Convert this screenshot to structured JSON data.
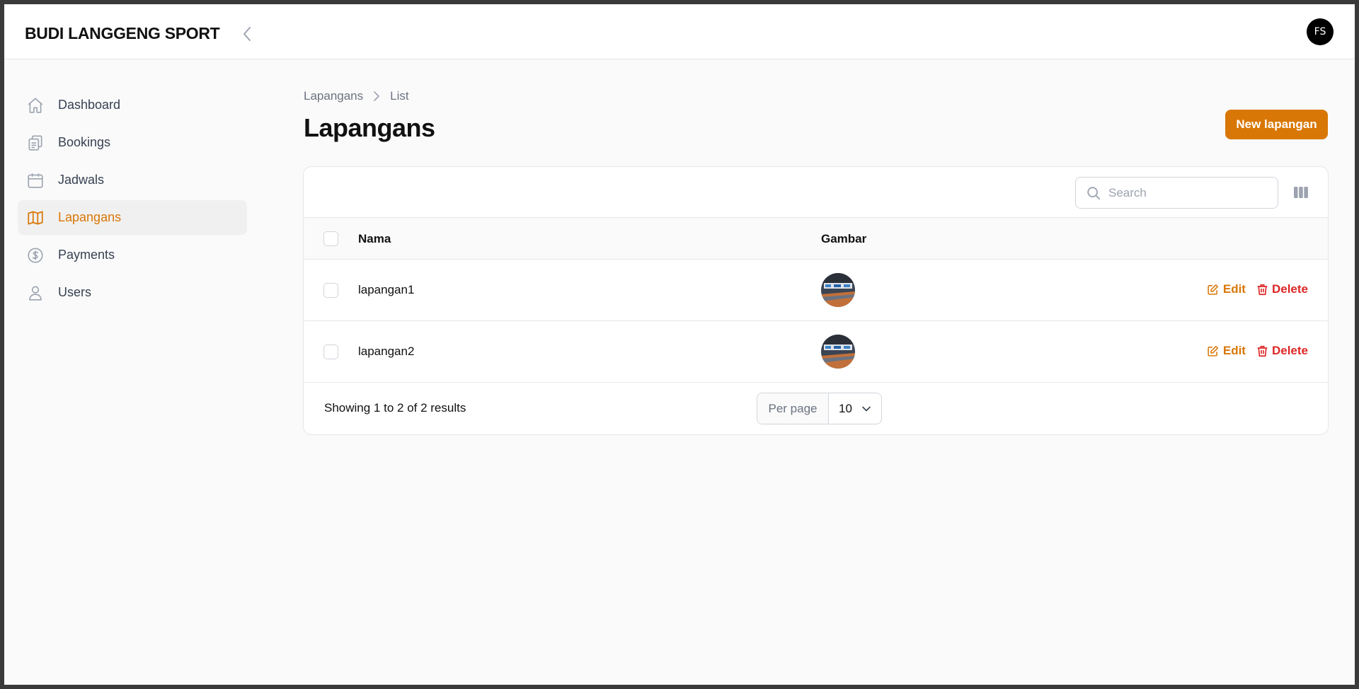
{
  "app": {
    "brand": "BUDI LANGGENG SPORT",
    "avatar_initials": "FS",
    "accent_color": "#d97706",
    "danger_color": "#dc2626"
  },
  "sidebar": {
    "items": [
      {
        "label": "Dashboard",
        "icon": "home-icon"
      },
      {
        "label": "Bookings",
        "icon": "clipboard-icon"
      },
      {
        "label": "Jadwals",
        "icon": "calendar-icon"
      },
      {
        "label": "Lapangans",
        "icon": "map-icon",
        "active": true
      },
      {
        "label": "Payments",
        "icon": "dollar-circle-icon"
      },
      {
        "label": "Users",
        "icon": "user-icon"
      }
    ]
  },
  "breadcrumb": {
    "items": [
      "Lapangans",
      "List"
    ]
  },
  "page": {
    "title": "Lapangans",
    "new_button": "New lapangan"
  },
  "table": {
    "search_placeholder": "Search",
    "columns": [
      "Nama",
      "Gambar"
    ],
    "rows": [
      {
        "nama": "lapangan1",
        "edit": "Edit",
        "delete": "Delete"
      },
      {
        "nama": "lapangan2",
        "edit": "Edit",
        "delete": "Delete"
      }
    ],
    "footer": {
      "results_text": "Showing 1 to 2 of 2 results",
      "per_page_label": "Per page",
      "per_page_value": "10"
    }
  }
}
